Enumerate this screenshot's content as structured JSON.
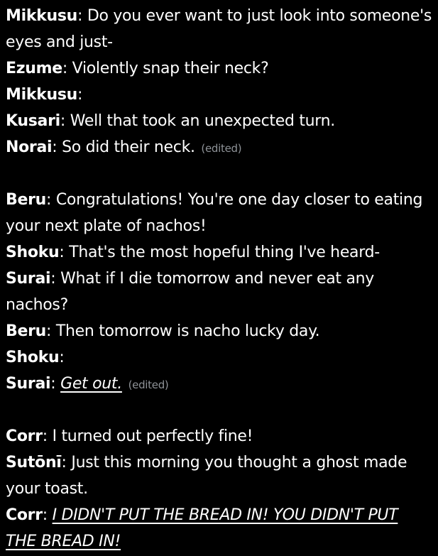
{
  "conversation": [
    {
      "speaker": "Mikkusu",
      "text": "Do you ever want to just look into someone's eyes and just-"
    },
    {
      "speaker": "Ezume",
      "text": "Violently snap their neck?"
    },
    {
      "speaker": "Mikkusu",
      "text": ""
    },
    {
      "speaker": "Kusari",
      "text": "Well that took an unexpected turn."
    },
    {
      "speaker": "Norai",
      "text": "So did their neck.",
      "edited": "(edited)"
    },
    {
      "speaker": "Beru",
      "text": "Congratulations! You're one day closer to eating your next plate of nachos!"
    },
    {
      "speaker": "Shoku",
      "text": "That's the most hopeful thing I've heard-"
    },
    {
      "speaker": "Surai",
      "text": "What if I die tomorrow and never eat any nachos?"
    },
    {
      "speaker": "Beru",
      "text": "Then tomorrow is nacho lucky day."
    },
    {
      "speaker": "Shoku",
      "text": ""
    },
    {
      "speaker": "Surai",
      "text": "Get out.",
      "edited": "(edited)"
    },
    {
      "speaker": "Corr",
      "text": "I turned out perfectly fine!"
    },
    {
      "speaker": "Sutōnī",
      "text": "Just this morning you thought a ghost made your toast."
    },
    {
      "speaker": "Corr",
      "text": "I DIDN'T PUT THE BREAD IN! YOU DIDN'T PUT THE BREAD IN!"
    }
  ],
  "separator": ":"
}
